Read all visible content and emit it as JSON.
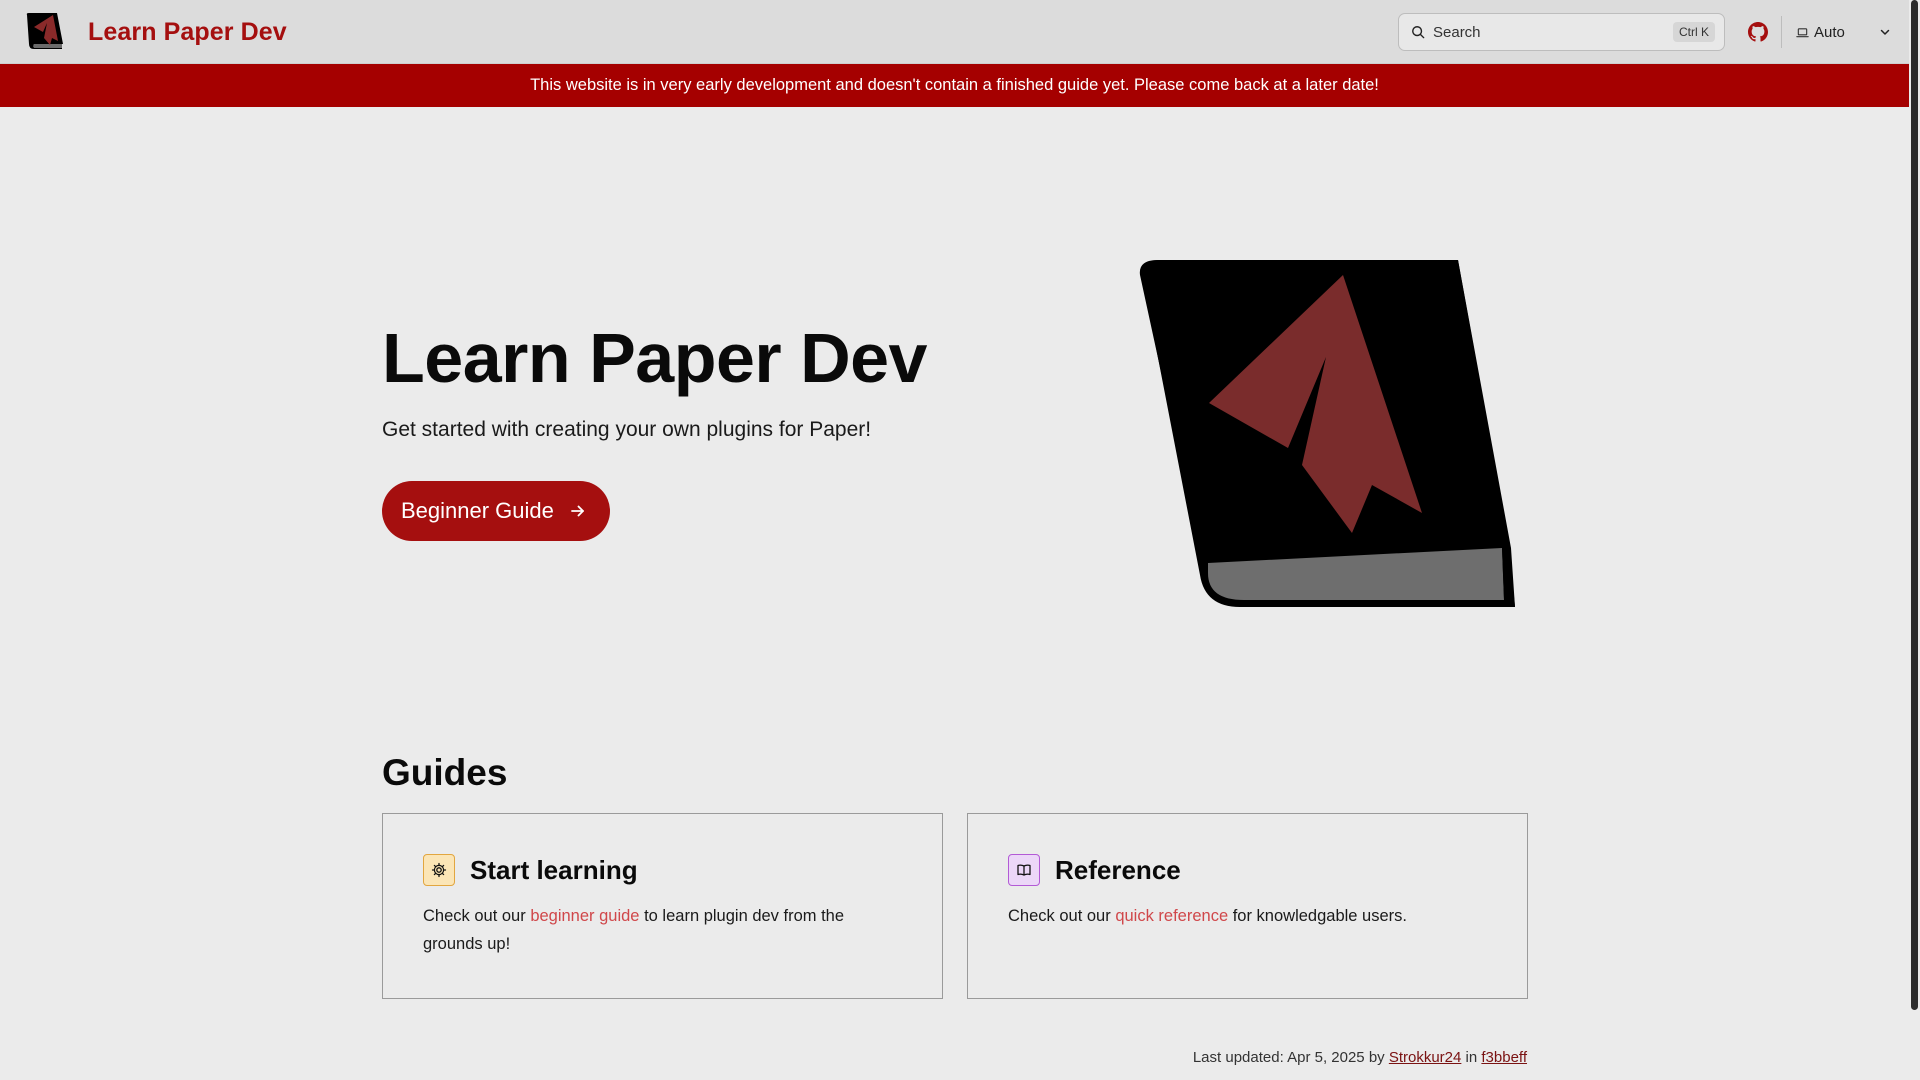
{
  "nav": {
    "title": "Learn Paper Dev",
    "search_placeholder": "Search",
    "search_shortcut": "Ctrl K",
    "theme": {
      "selected": "Auto"
    }
  },
  "banner": {
    "text": "This website is in very early development and doesn't contain a finished guide yet. Please come back at a later date!"
  },
  "hero": {
    "title": "Learn Paper Dev",
    "tagline": "Get started with creating your own plugins for Paper!",
    "cta_label": "Beginner Guide"
  },
  "guides": {
    "title": "Guides",
    "cards": [
      {
        "title": "Start learning",
        "icon": "gear-icon",
        "text_before": "Check out our ",
        "link_text": "beginner guide",
        "text_after": " to learn plugin dev from the grounds up!"
      },
      {
        "title": "Reference",
        "icon": "book-icon",
        "text_before": "Check out our ",
        "link_text": "quick reference",
        "text_after": " for knowledgable users."
      }
    ]
  },
  "footer": {
    "updated_prefix": "Last updated: Apr 5, 2025 by ",
    "author": "Strokkur24",
    "in_text": " in ",
    "commit": "f3bbeff"
  },
  "colors": {
    "accent": "#a50f0f",
    "banner": "#a50000",
    "link": "#d0474a",
    "background": "#ebebeb"
  }
}
